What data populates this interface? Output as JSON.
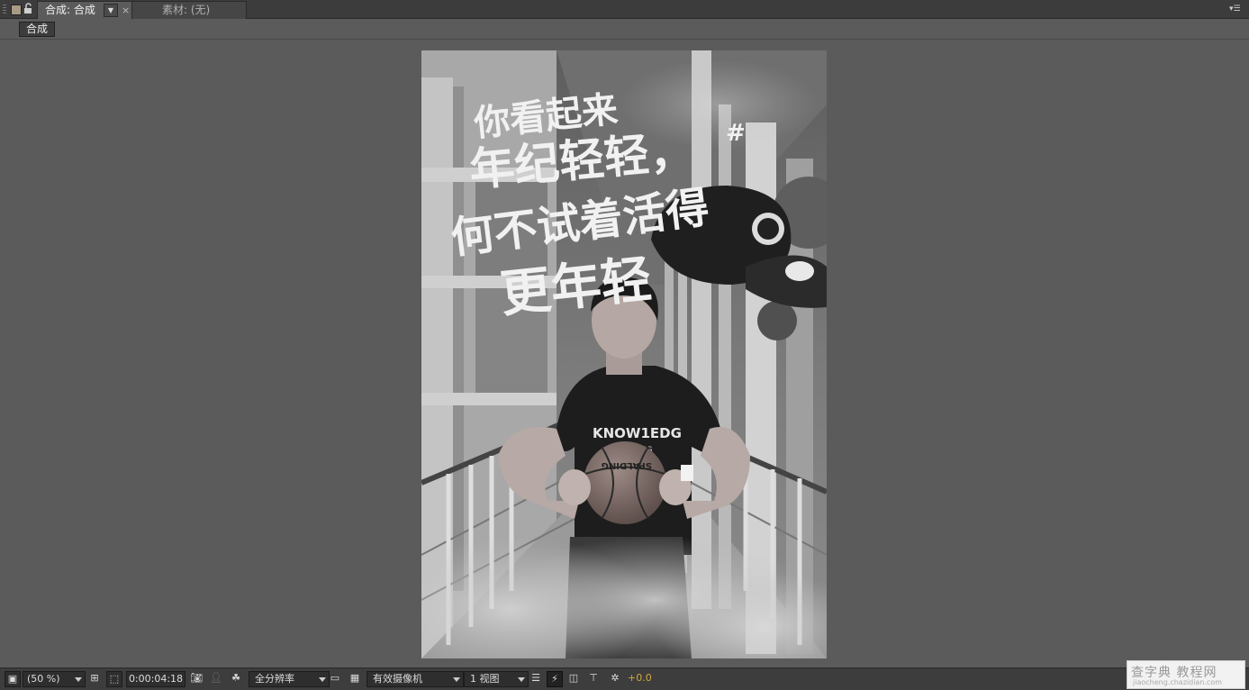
{
  "tabs": [
    {
      "label": "合成: 合成",
      "active": true
    },
    {
      "label": "素材: (无)",
      "active": false
    }
  ],
  "breadcrumb": {
    "label": "合成"
  },
  "poster": {
    "calligraphy": [
      "你看起来",
      "年纪轻轻，",
      "何不试着活得",
      "更年轻"
    ],
    "hash": "#",
    "shirt_text": "KNOW1EDG",
    "shirt_sub": "WORKING",
    "ball_text": "SPALDING"
  },
  "toolbar": {
    "zoom": "(50 %)",
    "timecode": "0:00:04:18",
    "resolution": "全分辨率",
    "camera": "有效摄像机",
    "views": "1 视图",
    "exposure": "+0.0"
  },
  "watermark": {
    "main": "查字典 教程网",
    "sub": "jiaocheng.chazidian.com"
  },
  "colors": {
    "panel_bg": "#5b5b5b",
    "tab_bar": "#3c3c3c",
    "exposure": "#d4a93b"
  }
}
